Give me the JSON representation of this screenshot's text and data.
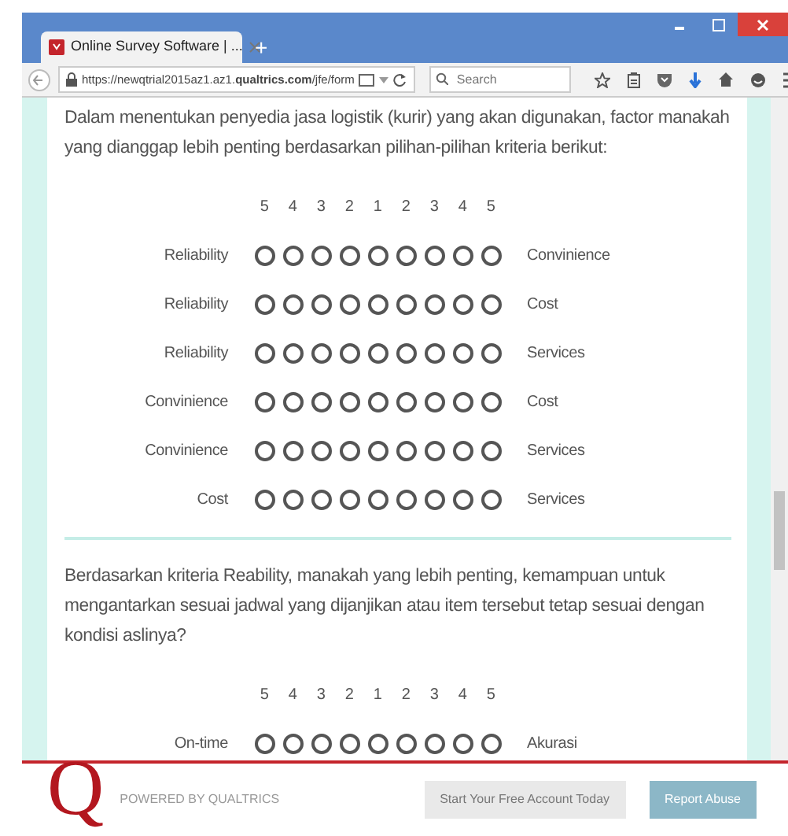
{
  "browser": {
    "tab_title": "Online Survey Software | ...",
    "new_tab": "+",
    "url": "https://newqtrial2015az1.az1.**qualtrics.com**/jfe/form",
    "search": {
      "placeholder": "Search"
    }
  },
  "questions": [
    {
      "text": "Dalam menentukan penyedia jasa logistik (kurir) yang akan digunakan, factor manakah yang dianggap lebih penting berdasarkan pilihan-pilihan kriteria berikut:",
      "scale": [
        "5",
        "4",
        "3",
        "2",
        "1",
        "2",
        "3",
        "4",
        "5"
      ],
      "rows": [
        {
          "left": "Reliability",
          "right": "Convinience",
          "options": [
            {
              "selected": false
            },
            {
              "selected": false
            },
            {
              "selected": false
            },
            {
              "selected": false
            },
            {
              "selected": false
            },
            {
              "selected": false
            },
            {
              "selected": false
            },
            {
              "selected": false
            },
            {
              "selected": false
            }
          ]
        },
        {
          "left": "Reliability",
          "right": "Cost",
          "options": [
            {
              "selected": false
            },
            {
              "selected": false
            },
            {
              "selected": false
            },
            {
              "selected": false
            },
            {
              "selected": false
            },
            {
              "selected": false
            },
            {
              "selected": false
            },
            {
              "selected": false
            },
            {
              "selected": false
            }
          ]
        },
        {
          "left": "Reliability",
          "right": "Services",
          "options": [
            {
              "selected": false
            },
            {
              "selected": false
            },
            {
              "selected": false
            },
            {
              "selected": false
            },
            {
              "selected": false
            },
            {
              "selected": false
            },
            {
              "selected": false
            },
            {
              "selected": false
            },
            {
              "selected": false
            }
          ]
        },
        {
          "left": "Convinience",
          "right": "Cost",
          "options": [
            {
              "selected": false
            },
            {
              "selected": false
            },
            {
              "selected": false
            },
            {
              "selected": false
            },
            {
              "selected": false
            },
            {
              "selected": false
            },
            {
              "selected": false
            },
            {
              "selected": false
            },
            {
              "selected": false
            }
          ]
        },
        {
          "left": "Convinience",
          "right": "Services",
          "options": [
            {
              "selected": false
            },
            {
              "selected": false
            },
            {
              "selected": false
            },
            {
              "selected": false
            },
            {
              "selected": false
            },
            {
              "selected": false
            },
            {
              "selected": false
            },
            {
              "selected": false
            },
            {
              "selected": false
            }
          ]
        },
        {
          "left": "Cost",
          "right": "Services",
          "options": [
            {
              "selected": false
            },
            {
              "selected": false
            },
            {
              "selected": false
            },
            {
              "selected": false
            },
            {
              "selected": false
            },
            {
              "selected": false
            },
            {
              "selected": false
            },
            {
              "selected": false
            },
            {
              "selected": false
            }
          ]
        }
      ]
    },
    {
      "text": "Berdasarkan kriteria Reability, manakah yang lebih penting, kemampuan untuk mengantarkan sesuai jadwal yang dijanjikan atau item tersebut tetap sesuai dengan kondisi aslinya?",
      "scale": [
        "5",
        "4",
        "3",
        "2",
        "1",
        "2",
        "3",
        "4",
        "5"
      ],
      "rows": [
        {
          "left": "On-time",
          "right": "Akurasi",
          "options": [
            {
              "selected": false
            },
            {
              "selected": false
            },
            {
              "selected": false
            },
            {
              "selected": false
            },
            {
              "selected": false
            },
            {
              "selected": false
            },
            {
              "selected": false
            },
            {
              "selected": false
            },
            {
              "selected": false
            }
          ]
        }
      ]
    }
  ],
  "footer": {
    "logo": "Q",
    "powered_by": "POWERED BY QUALTRICS",
    "buttons": [
      "Start Your Free Account Today",
      "Report Abuse"
    ]
  }
}
